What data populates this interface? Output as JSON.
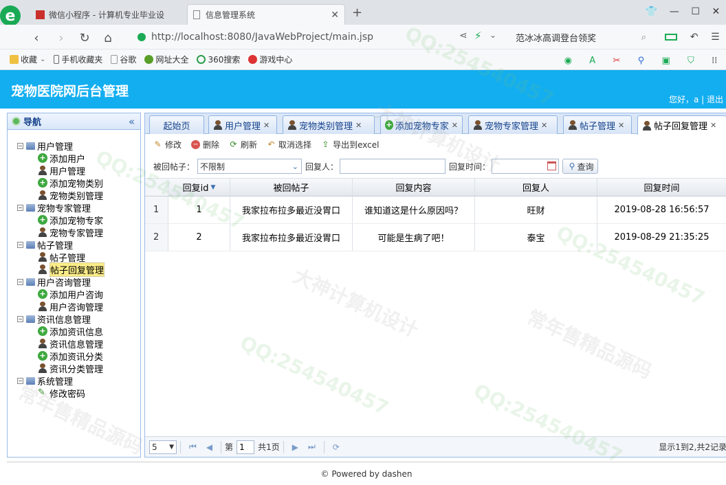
{
  "browser": {
    "tabs": [
      {
        "label": "微信小程序 - 计算机专业毕业设"
      },
      {
        "label": "信息管理系统"
      }
    ],
    "url": "http://localhost:8080/JavaWebProject/main.jsp",
    "search_hint": "范冰冰高调登台领奖",
    "bookmarks": [
      "收藏",
      "手机收藏夹",
      "谷歌",
      "网址大全",
      "360搜索",
      "游戏中心"
    ]
  },
  "app": {
    "title": "宠物医院网后台管理",
    "user_text": "您好，a | 退出"
  },
  "sidebar": {
    "title": "导航",
    "collapse_glyph": "«",
    "items": [
      {
        "label": "用户管理",
        "level": 1,
        "icon": "folder-icon"
      },
      {
        "label": "添加用户",
        "level": 2,
        "icon": "add-icon"
      },
      {
        "label": "用户管理",
        "level": 2,
        "icon": "user-icon"
      },
      {
        "label": "添加宠物类别",
        "level": 2,
        "icon": "add-icon"
      },
      {
        "label": "宠物类别管理",
        "level": 2,
        "icon": "user-icon"
      },
      {
        "label": "宠物专家管理",
        "level": 1,
        "icon": "folder-icon"
      },
      {
        "label": "添加宠物专家",
        "level": 2,
        "icon": "add-icon"
      },
      {
        "label": "宠物专家管理",
        "level": 2,
        "icon": "user-icon"
      },
      {
        "label": "帖子管理",
        "level": 1,
        "icon": "folder-icon"
      },
      {
        "label": "帖子管理",
        "level": 2,
        "icon": "user-icon"
      },
      {
        "label": "帖子回复管理",
        "level": 2,
        "icon": "user-icon",
        "selected": true
      },
      {
        "label": "用户咨询管理",
        "level": 1,
        "icon": "folder-icon"
      },
      {
        "label": "添加用户咨询",
        "level": 2,
        "icon": "add-icon"
      },
      {
        "label": "用户咨询管理",
        "level": 2,
        "icon": "user-icon"
      },
      {
        "label": "资讯信息管理",
        "level": 1,
        "icon": "folder-icon"
      },
      {
        "label": "添加资讯信息",
        "level": 2,
        "icon": "add-icon"
      },
      {
        "label": "资讯信息管理",
        "level": 2,
        "icon": "user-icon"
      },
      {
        "label": "添加资讯分类",
        "level": 2,
        "icon": "add-icon"
      },
      {
        "label": "资讯分类管理",
        "level": 2,
        "icon": "user-icon"
      },
      {
        "label": "系统管理",
        "level": 1,
        "icon": "folder-icon"
      },
      {
        "label": "修改密码",
        "level": 2,
        "icon": "pencil-icon"
      }
    ]
  },
  "main": {
    "tabs": [
      {
        "label": "起始页",
        "closable": false
      },
      {
        "label": "用户管理",
        "closable": true
      },
      {
        "label": "宠物类别管理",
        "closable": true
      },
      {
        "label": "添加宠物专家",
        "closable": true
      },
      {
        "label": "宠物专家管理",
        "closable": true
      },
      {
        "label": "帖子管理",
        "closable": true
      },
      {
        "label": "帖子回复管理",
        "closable": true,
        "active": true
      }
    ],
    "toolbar": {
      "edit": "修改",
      "delete": "删除",
      "refresh": "刷新",
      "unselect": "取消选择",
      "export": "导出到excel"
    },
    "search": {
      "post_label": "被回帖子：",
      "post_value": "不限制",
      "replier_label": "回复人：",
      "replier_value": "",
      "time_label": "回复时间：",
      "time_value": "",
      "query_button": "查询"
    },
    "grid": {
      "columns": [
        "回复id",
        "被回帖子",
        "回复内容",
        "回复人",
        "回复时间"
      ],
      "rows": [
        {
          "num": "1",
          "id": "1",
          "post": "我家拉布拉多最近没胃口",
          "content": "谁知道这是什么原因吗？",
          "replier": "旺财",
          "time": "2019-08-28 16:56:57"
        },
        {
          "num": "2",
          "id": "2",
          "post": "我家拉布拉多最近没胃口",
          "content": "可能是生病了吧！",
          "replier": "泰宝",
          "time": "2019-08-29 21:35:25"
        }
      ]
    },
    "pager": {
      "page_size": "5",
      "page_prefix": "第",
      "page_value": "1",
      "page_total": "共1页",
      "summary": "显示1到2,共2记录"
    }
  },
  "footer": {
    "text": "© Powered by dashen"
  },
  "watermarks": [
    "QQ:254540457",
    "大神计算机设计",
    "常年售精品源码"
  ]
}
